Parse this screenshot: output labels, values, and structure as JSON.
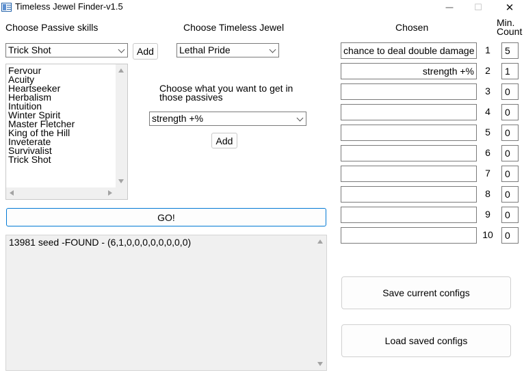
{
  "window": {
    "title": "Timeless Jewel Finder-v1.5",
    "minimize_glyph": "—",
    "maximize_glyph": "☐",
    "close_glyph": "✕"
  },
  "passive": {
    "heading": "Choose Passive skills",
    "selected": "Trick Shot",
    "add_label": "Add",
    "list": [
      "Fervour",
      "Acuity",
      "Heartseeker",
      "Herbalism",
      "Intuition",
      "Winter Spirit",
      "Master Fletcher",
      "King of the Hill",
      "Inveterate",
      "Survivalist",
      "Trick Shot"
    ]
  },
  "jewel": {
    "heading": "Choose Timeless Jewel",
    "selected": "Lethal Pride",
    "prompt": "Choose what you want to get in those passives",
    "stat_selected": "strength +%",
    "add_label": "Add"
  },
  "go_label": "GO!",
  "result": "13981 seed -FOUND - (6,1,0,0,0,0,0,0,0,0)",
  "chosen": {
    "heading": "Chosen",
    "count_heading": "Min. Count",
    "rows": [
      {
        "num": "1",
        "value": "chance to deal double damage",
        "count": "5"
      },
      {
        "num": "2",
        "value": "strength +%",
        "count": "1"
      },
      {
        "num": "3",
        "value": "",
        "count": "0"
      },
      {
        "num": "4",
        "value": "",
        "count": "0"
      },
      {
        "num": "5",
        "value": "",
        "count": "0"
      },
      {
        "num": "6",
        "value": "",
        "count": "0"
      },
      {
        "num": "7",
        "value": "",
        "count": "0"
      },
      {
        "num": "8",
        "value": "",
        "count": "0"
      },
      {
        "num": "9",
        "value": "",
        "count": "0"
      },
      {
        "num": "10",
        "value": "",
        "count": "0"
      }
    ]
  },
  "save_label": "Save current configs",
  "load_label": "Load saved configs"
}
